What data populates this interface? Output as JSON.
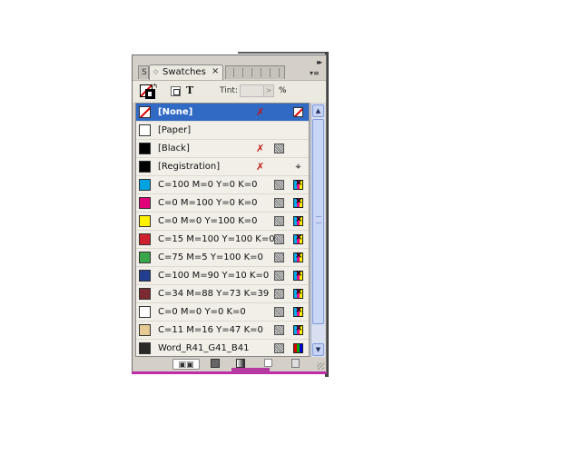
{
  "panel": {
    "title": "Swatches",
    "stub_tab_label": "S",
    "close_glyph": "×",
    "collapse_glyph": "▸▸",
    "menu_glyph": "▾≡",
    "tint_label": "Tint:",
    "tint_value": "",
    "tint_percent": "%",
    "text_button": "T"
  },
  "swatches": [
    {
      "name": "[None]",
      "color": "none",
      "selected": true,
      "icon1": "pencil-x-icon",
      "icon2": "none-icon"
    },
    {
      "name": "[Paper]",
      "color": "#ffffff",
      "selected": false,
      "icon1": "",
      "icon2": ""
    },
    {
      "name": "[Black]",
      "color": "#000000",
      "selected": false,
      "icon1": "pencil-x-icon",
      "icon2": "process-icon"
    },
    {
      "name": "[Registration]",
      "color": "#000000",
      "selected": false,
      "icon1": "pencil-x-icon",
      "icon2": "registration-icon"
    },
    {
      "name": "C=100 M=0 Y=0 K=0",
      "color": "#00a3e0",
      "selected": false,
      "icon1": "process-icon",
      "icon2": "cmyk-icon"
    },
    {
      "name": "C=0 M=100 Y=0 K=0",
      "color": "#e2007a",
      "selected": false,
      "icon1": "process-icon",
      "icon2": "cmyk-icon"
    },
    {
      "name": "C=0 M=0 Y=100 K=0",
      "color": "#fff200",
      "selected": false,
      "icon1": "process-icon",
      "icon2": "cmyk-icon"
    },
    {
      "name": "C=15 M=100 Y=100 K=0",
      "color": "#d0202e",
      "selected": false,
      "icon1": "process-icon",
      "icon2": "cmyk-icon"
    },
    {
      "name": "C=75 M=5 Y=100 K=0",
      "color": "#3aa64a",
      "selected": false,
      "icon1": "process-icon",
      "icon2": "cmyk-icon"
    },
    {
      "name": "C=100 M=90 Y=10 K=0",
      "color": "#233d8f",
      "selected": false,
      "icon1": "process-icon",
      "icon2": "cmyk-icon"
    },
    {
      "name": "C=34 M=88 Y=73 K=39",
      "color": "#7a2a30",
      "selected": false,
      "icon1": "process-icon",
      "icon2": "cmyk-icon"
    },
    {
      "name": "C=0 M=0 Y=0 K=0",
      "color": "#ffffff",
      "selected": false,
      "icon1": "process-icon",
      "icon2": "cmyk-icon"
    },
    {
      "name": "C=11 M=16 Y=47 K=0",
      "color": "#e6cc94",
      "selected": false,
      "icon1": "process-icon",
      "icon2": "cmyk-icon"
    },
    {
      "name": "Word_R41_G41_B41",
      "color": "#292929",
      "selected": false,
      "icon1": "process-icon",
      "icon2": "rgb-icon"
    }
  ],
  "scrollbar": {
    "up_glyph": "▲",
    "down_glyph": "▼"
  }
}
